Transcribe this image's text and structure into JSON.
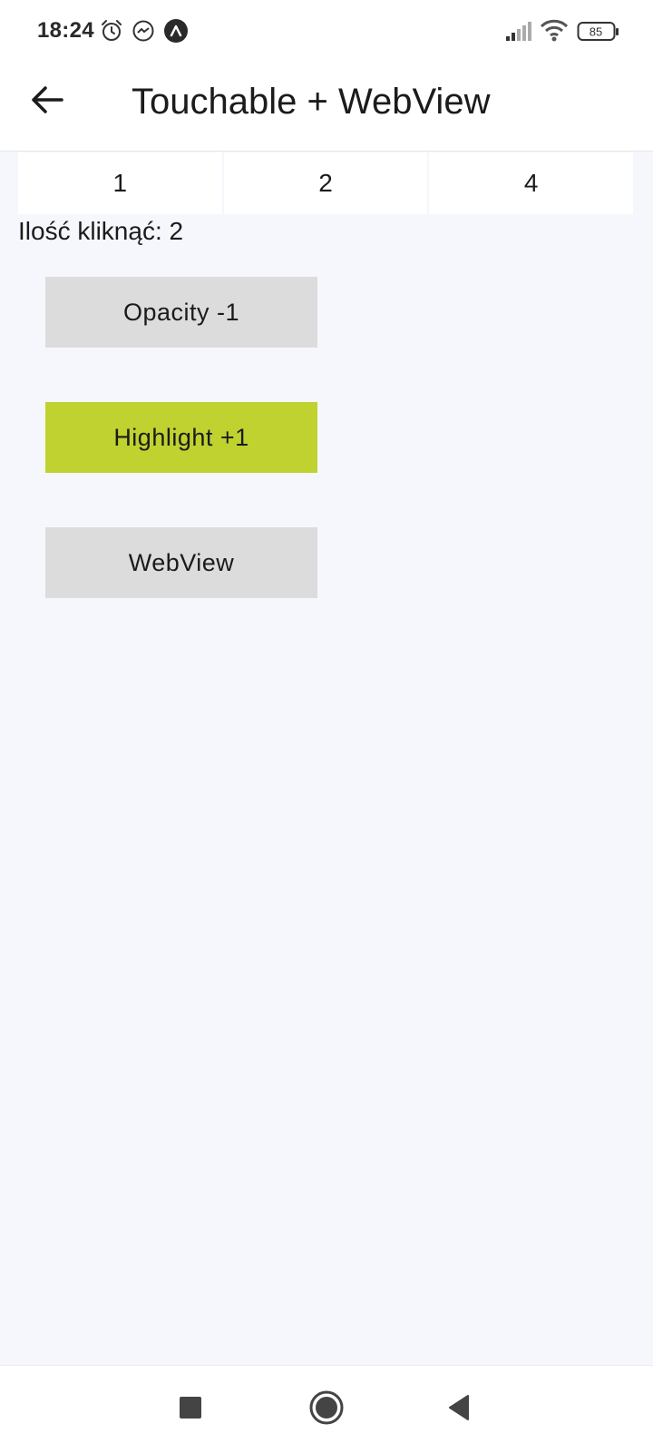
{
  "status_bar": {
    "time": "18:24",
    "battery": "85",
    "icons": [
      "alarm-icon",
      "messenger-icon",
      "expo-icon",
      "cellular-signal-icon",
      "wifi-icon",
      "battery-icon"
    ]
  },
  "app_bar": {
    "title": "Touchable + WebView",
    "back_icon": "arrow-left-icon"
  },
  "tabs": [
    {
      "label": "1"
    },
    {
      "label": "2"
    },
    {
      "label": "4"
    }
  ],
  "counter": {
    "text": "Ilość kliknąć: 2"
  },
  "buttons": {
    "opacity": "Opacity -1",
    "highlight": "Highlight +1",
    "webview": "WebView"
  },
  "colors": {
    "background": "#f6f7fc",
    "highlight_button": "#bfd22f",
    "default_button": "#dcdcdc"
  },
  "nav_bar": {
    "icons": [
      "recents-square-icon",
      "home-circle-icon",
      "back-triangle-icon"
    ]
  }
}
